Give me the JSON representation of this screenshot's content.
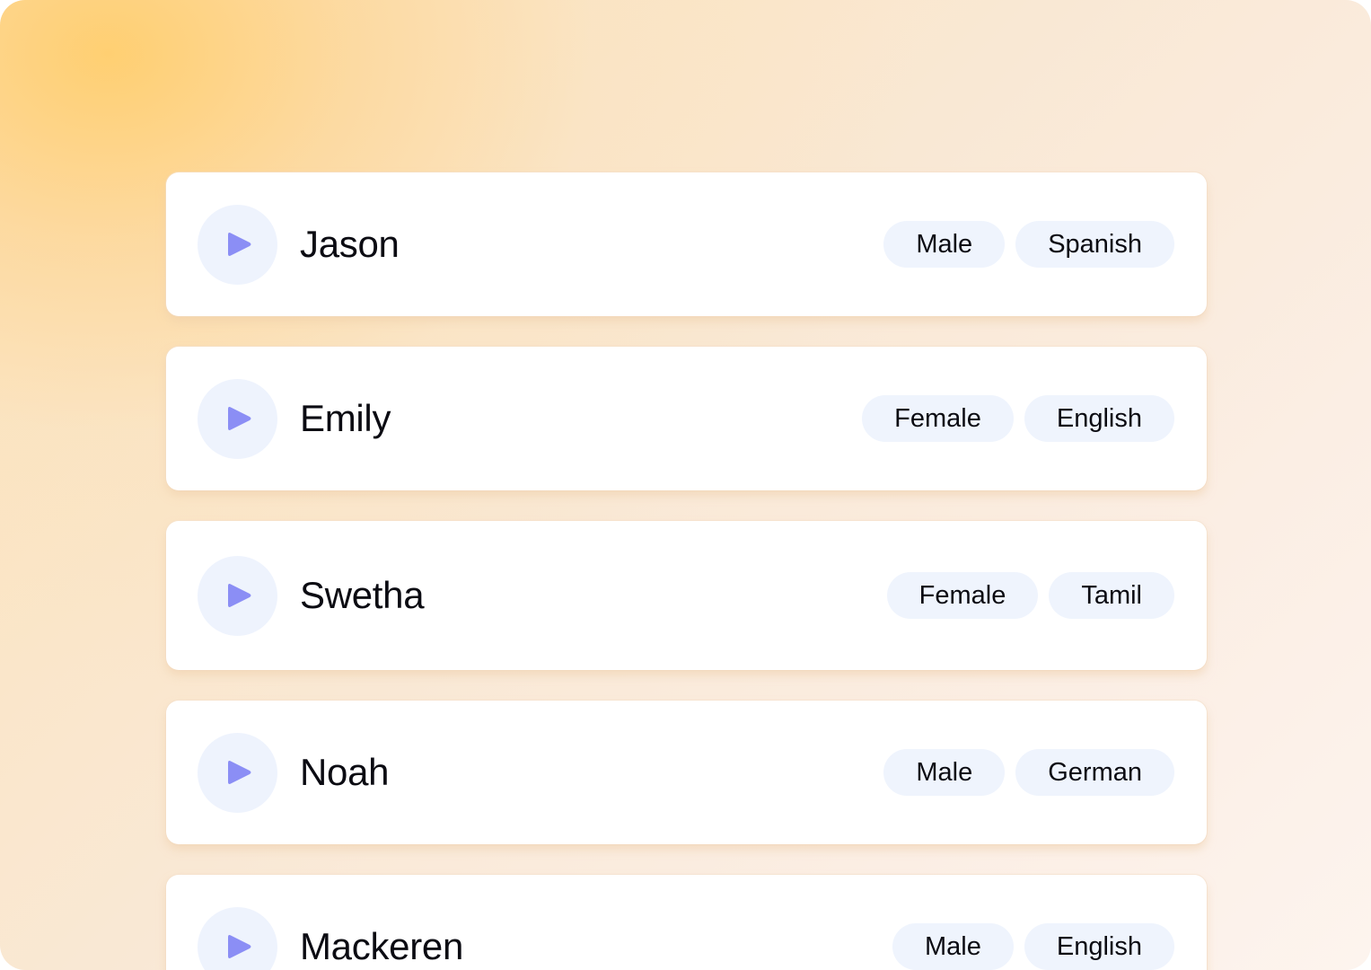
{
  "voices": [
    {
      "name": "Jason",
      "gender": "Male",
      "language": "Spanish"
    },
    {
      "name": "Emily",
      "gender": "Female",
      "language": "English"
    },
    {
      "name": "Swetha",
      "gender": "Female",
      "language": "Tamil"
    },
    {
      "name": "Noah",
      "gender": "Male",
      "language": "German"
    },
    {
      "name": "Mackeren",
      "gender": "Male",
      "language": "English"
    }
  ],
  "colors": {
    "play_icon": "#8b8ef5",
    "play_bg": "#eef3fd",
    "tag_bg": "#eff4fd",
    "text": "#0b0b12"
  },
  "icons": {
    "play": "play-icon"
  }
}
